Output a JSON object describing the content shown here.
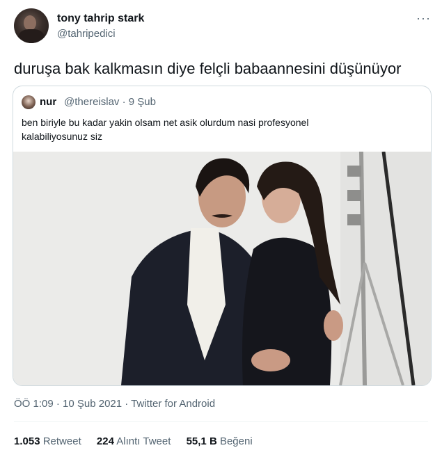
{
  "author": {
    "name": "tony tahrip stark",
    "handle": "@tahripedici"
  },
  "more_icon": "more-horizontal-icon",
  "tweet_text": "duruşa bak kalkmasın diye felçli babaannesini düşünüyor",
  "quoted": {
    "name": "nur",
    "handle_date": "@thereislav · 9 Şub",
    "text_line1": "ben biriyle bu kadar yakin olsam net asik olurdum nasi profesyonel",
    "text_line2": "kalabiliyosunuz siz"
  },
  "meta": "ÖÖ 1:09 · 10 Şub 2021 · Twitter for Android",
  "stats": {
    "retweets_count": "1.053",
    "retweets_label": "Retweet",
    "quotes_count": "224",
    "quotes_label": "Alıntı Tweet",
    "likes_count": "55,1 B",
    "likes_label": "Beğeni"
  },
  "colors": {
    "text_primary": "#0f1419",
    "text_secondary": "#536471",
    "border": "#cfd9de"
  }
}
